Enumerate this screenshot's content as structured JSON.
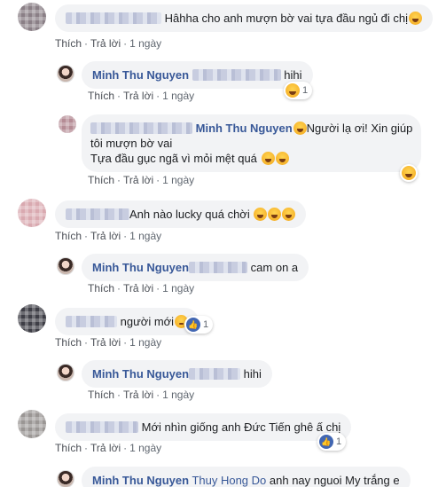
{
  "actions": {
    "like": "Thích",
    "reply": "Trả lời",
    "dot": "·"
  },
  "comments": [
    {
      "text": "Hâhha cho anh mượn bờ vai tựa đầu ngủ đi chị",
      "time": "1 ngày"
    },
    {
      "name": "Minh Thu Nguyen",
      "text": "hihi",
      "time": "1 ngày",
      "reaction_count": "1"
    },
    {
      "name": "Minh Thu Nguyen",
      "line1": "Người lạ ơi! Xin giúp",
      "line2": "tôi mượn bờ vai",
      "line3": "Tựa đầu gục ngã vì mỏi mệt quá",
      "time": "1 ngày"
    },
    {
      "text": "Anh nào lucky quá chời",
      "time": "1 ngày"
    },
    {
      "name": "Minh Thu Nguyen",
      "text": "cam on a",
      "time": "1 ngày"
    },
    {
      "text": "người mới",
      "time": "1 ngày",
      "reaction_count": "1"
    },
    {
      "name": "Minh Thu Nguyen",
      "text": "hihi",
      "time": "1 ngày"
    },
    {
      "text": "Mới nhìn giống anh Đức Tiến ghê ấ chị",
      "time": "1 ngày",
      "reaction_count": "1"
    },
    {
      "name": "Minh Thu Nguyen",
      "mention": "Thuy Hong Do",
      "text": "anh nay nguoi My trắng e"
    }
  ],
  "icons": {
    "laugh": "laugh-emoji",
    "like": "like-reaction"
  }
}
